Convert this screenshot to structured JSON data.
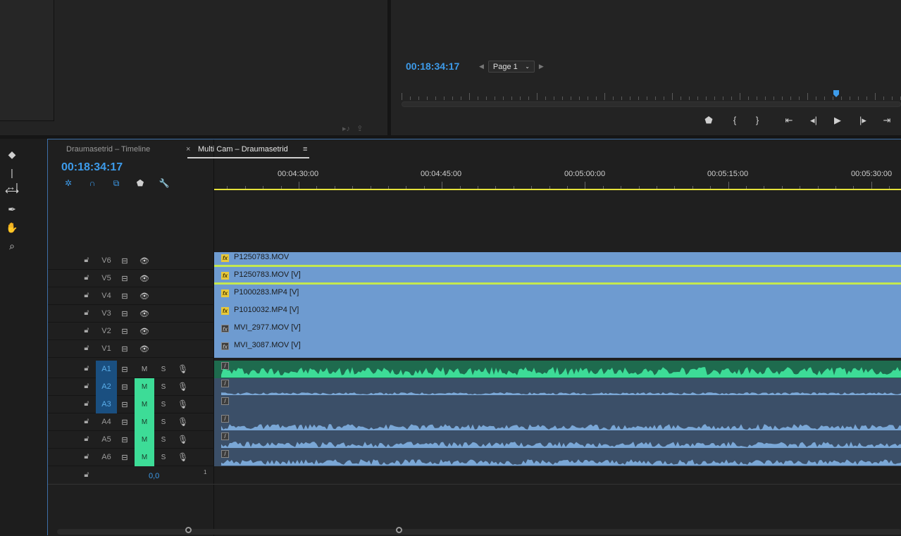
{
  "program_monitor": {
    "timecode": "00:18:34:17",
    "page_selector": "Page 1"
  },
  "timeline": {
    "tabs": [
      {
        "label": "Draumasetrid – Timeline",
        "active": false
      },
      {
        "label": "Multi Cam – Draumasetrid",
        "active": true
      }
    ],
    "timecode": "00:18:34:17",
    "ruler_labels": [
      "00:04:30:00",
      "00:04:45:00",
      "00:05:00:00",
      "00:05:15:00",
      "00:05:30:00"
    ],
    "video_tracks": [
      {
        "name": "V6",
        "clip": "P1250783.MOV",
        "fx": "yellow"
      },
      {
        "name": "V5",
        "clip": "P1250783.MOV [V]",
        "fx": "yellow"
      },
      {
        "name": "V4",
        "clip": "P1000283.MP4 [V]",
        "fx": "yellow"
      },
      {
        "name": "V3",
        "clip": "P1010032.MP4 [V]",
        "fx": "yellow"
      },
      {
        "name": "V2",
        "clip": "MVI_2977.MOV [V]",
        "fx": "gray"
      },
      {
        "name": "V1",
        "clip": "MVI_3087.MOV [V]",
        "fx": "gray"
      }
    ],
    "audio_tracks": [
      {
        "name": "A1",
        "selected": true,
        "mute": "M",
        "mute_on": false,
        "solo": "S"
      },
      {
        "name": "A2",
        "selected": true,
        "mute": "M",
        "mute_on": true,
        "solo": "S"
      },
      {
        "name": "A3",
        "selected": true,
        "mute": "M",
        "mute_on": true,
        "solo": "S"
      },
      {
        "name": "A4",
        "selected": false,
        "mute": "M",
        "mute_on": true,
        "solo": "S"
      },
      {
        "name": "A5",
        "selected": false,
        "mute": "M",
        "mute_on": true,
        "solo": "S"
      },
      {
        "name": "A6",
        "selected": false,
        "mute": "M",
        "mute_on": true,
        "solo": "S"
      }
    ],
    "master_value": "0,0",
    "master_sub": "1"
  },
  "icons": {
    "tools": [
      "razor-icon",
      "ripple-edit-icon",
      "slip-icon",
      "pen-icon",
      "hand-icon",
      "zoom-icon"
    ],
    "transport": [
      "add-marker-icon",
      "mark-in-icon",
      "mark-out-icon",
      "go-to-in-icon",
      "step-back-icon",
      "play-icon",
      "step-forward-icon",
      "go-to-out-icon"
    ]
  },
  "colors": {
    "accent": "#3d9bea",
    "video_clip": "#6e9bd0",
    "audio_clip": "#3b4f68",
    "audio_clip_active": "#1e6b4e",
    "mute_on": "#3ddc97",
    "work_area": "#e6e23a"
  }
}
